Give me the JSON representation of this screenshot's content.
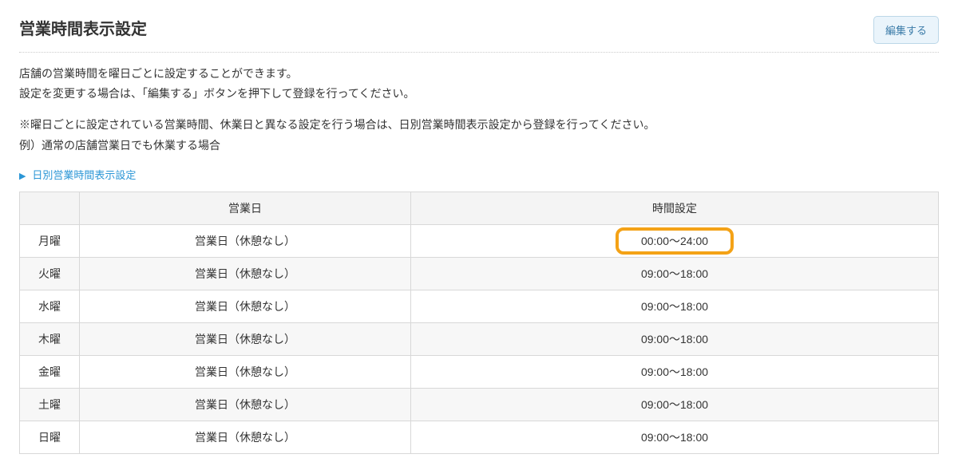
{
  "header": {
    "title": "営業時間表示設定",
    "edit_button": "編集する"
  },
  "description": {
    "line1": "店舗の営業時間を曜日ごとに設定することができます。",
    "line2": "設定を変更する場合は、「編集する」ボタンを押下して登録を行ってください。"
  },
  "note": {
    "line1": "※曜日ごとに設定されている営業時間、休業日と異なる設定を行う場合は、日別営業時間表示設定から登録を行ってください。",
    "line2": "例）通常の店舗営業日でも休業する場合"
  },
  "link": {
    "label": "日別営業時間表示設定"
  },
  "table": {
    "headers": {
      "day": "",
      "status": "営業日",
      "time": "時間設定"
    },
    "rows": [
      {
        "day": "月曜",
        "status": "営業日（休憩なし）",
        "time": "00:00〜24:00",
        "highlight": true
      },
      {
        "day": "火曜",
        "status": "営業日（休憩なし）",
        "time": "09:00〜18:00",
        "highlight": false
      },
      {
        "day": "水曜",
        "status": "営業日（休憩なし）",
        "time": "09:00〜18:00",
        "highlight": false
      },
      {
        "day": "木曜",
        "status": "営業日（休憩なし）",
        "time": "09:00〜18:00",
        "highlight": false
      },
      {
        "day": "金曜",
        "status": "営業日（休憩なし）",
        "time": "09:00〜18:00",
        "highlight": false
      },
      {
        "day": "土曜",
        "status": "営業日（休憩なし）",
        "time": "09:00〜18:00",
        "highlight": false
      },
      {
        "day": "日曜",
        "status": "営業日（休憩なし）",
        "time": "09:00〜18:00",
        "highlight": false
      }
    ]
  }
}
